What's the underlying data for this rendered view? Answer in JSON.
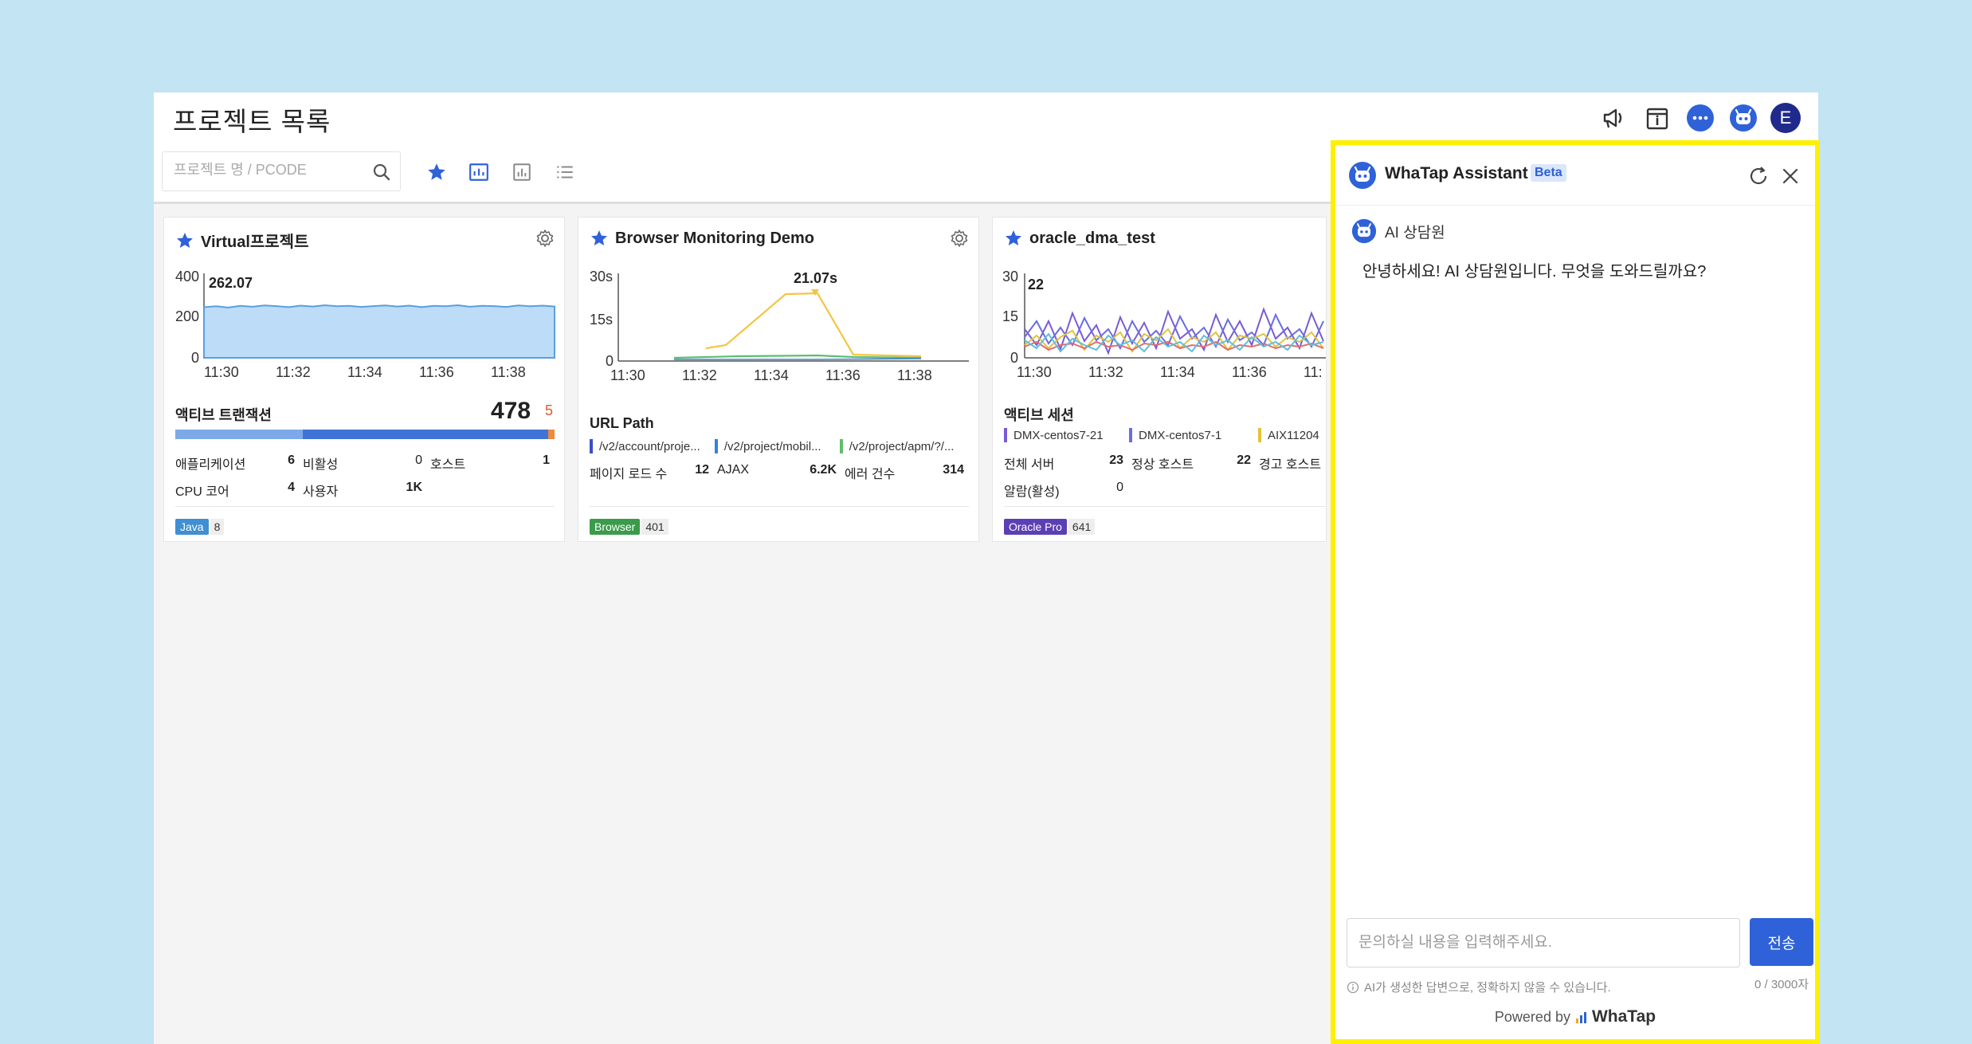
{
  "header": {
    "title": "프로젝트 목록",
    "avatar_letter": "E",
    "icons": [
      "megaphone-icon",
      "calendar-info-icon",
      "chat-bubble-icon",
      "assistant-bot-icon"
    ]
  },
  "toolbar": {
    "search_placeholder": "프로젝트 명 / PCODE"
  },
  "cards": [
    {
      "title": "Virtual프로젝트",
      "chart": {
        "type": "area",
        "y_ticks": [
          "400",
          "200",
          "0"
        ],
        "x_ticks": [
          "11:30",
          "11:32",
          "11:34",
          "11:36",
          "11:38"
        ],
        "peak_label": "262.07",
        "ylim": [
          0,
          400
        ],
        "values": [
          240,
          244,
          238,
          246,
          242,
          248,
          245,
          240,
          247,
          243,
          249,
          244,
          246,
          241,
          245,
          248,
          243,
          247,
          240,
          246,
          244,
          249,
          242,
          246,
          245,
          241,
          248,
          244,
          247,
          243
        ]
      },
      "metric_label": "액티브 트랜잭션",
      "metric_value": "478",
      "metric_extra": "5",
      "stats_row1": [
        {
          "k": "애플리케이션",
          "v": "6"
        },
        {
          "k": "비활성",
          "v": "0"
        },
        {
          "k": "호스트",
          "v": "1"
        }
      ],
      "stats_row2": [
        {
          "k": "CPU 코어",
          "v": "4"
        },
        {
          "k": "사용자",
          "v": "1K"
        }
      ],
      "tag": {
        "label": "Java",
        "count": "8",
        "color": "#3f8fd2"
      }
    },
    {
      "title": "Browser Monitoring Demo",
      "chart": {
        "type": "line",
        "y_ticks": [
          "30s",
          "15s",
          "0"
        ],
        "x_ticks": [
          "11:30",
          "11:32",
          "11:34",
          "11:36",
          "11:38"
        ],
        "peak_label": "21.07s",
        "ylim": [
          0,
          30
        ]
      },
      "section_label": "URL Path",
      "legend": [
        {
          "label": "/v2/account/proje...",
          "color": "#3a4fc4"
        },
        {
          "label": "/v2/project/mobil...",
          "color": "#3a7fd8"
        },
        {
          "label": "/v2/project/apm/?/...",
          "color": "#5fbf6a"
        }
      ],
      "stats_row1": [
        {
          "k": "페이지 로드 수",
          "v": "12"
        },
        {
          "k": "AJAX",
          "v": "6.2K"
        },
        {
          "k": "에러 건수",
          "v": "314"
        }
      ],
      "tag": {
        "label": "Browser",
        "count": "401",
        "color": "#3a9b4a"
      }
    },
    {
      "title": "oracle_dma_test",
      "chart": {
        "type": "line",
        "y_ticks": [
          "30",
          "15",
          "0"
        ],
        "x_ticks": [
          "11:30",
          "11:32",
          "11:34",
          "11:36",
          "11:"
        ],
        "peak_label": "22",
        "ylim": [
          0,
          30
        ]
      },
      "section_label": "액티브 세션",
      "legend": [
        {
          "label": "DMX-centos7-21",
          "color": "#7a5bd6"
        },
        {
          "label": "DMX-centos7-1",
          "color": "#6a6de0"
        },
        {
          "label": "AIX11204",
          "color": "#e2c33a"
        }
      ],
      "stats_row1": [
        {
          "k": "전체 서버",
          "v": "23"
        },
        {
          "k": "정상 호스트",
          "v": "22"
        },
        {
          "k": "경고 호스트",
          "v": ""
        }
      ],
      "stats_row2": [
        {
          "k": "알람(활성)",
          "v": "0"
        }
      ],
      "tag": {
        "label": "Oracle Pro",
        "count": "641",
        "color": "#5b3fb5"
      }
    }
  ],
  "assistant": {
    "title": "WhaTap Assistant",
    "beta": "Beta",
    "agent_name": "AI 상담원",
    "greeting": "안녕하세요! AI 상담원입니다. 무엇을 도와드릴까요?",
    "input_placeholder": "문의하실 내용을 입력해주세요.",
    "send_label": "전송",
    "disclaimer": "AI가 생성한 답변으로, 정확하지 않을 수 있습니다.",
    "counter": "0 / 3000자",
    "powered_by": "Powered by",
    "brand": "WhaTap"
  }
}
